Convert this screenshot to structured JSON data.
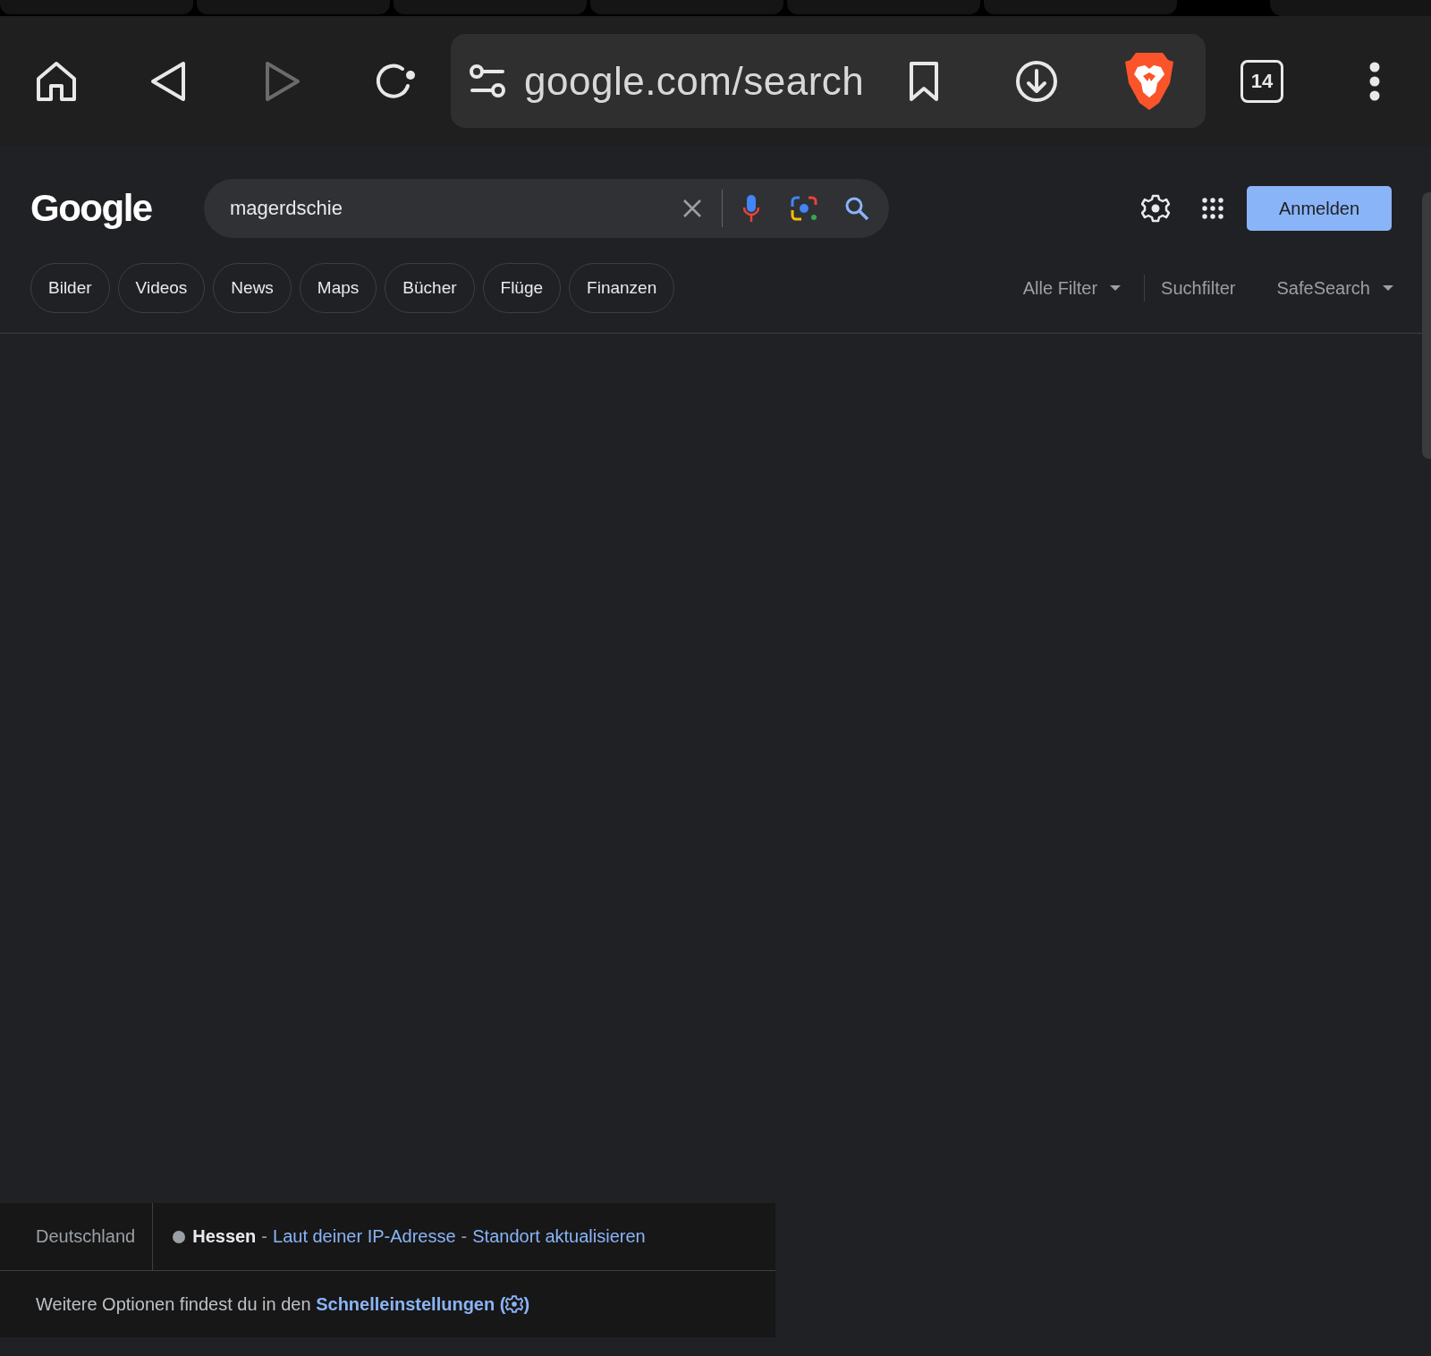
{
  "browser": {
    "nav": [
      {
        "kind": "home",
        "disabled": false
      },
      {
        "kind": "back",
        "disabled": false
      },
      {
        "kind": "forward",
        "disabled": true
      },
      {
        "kind": "reload",
        "disabled": false
      }
    ],
    "url": "google.com/search",
    "tab_count": "14"
  },
  "header": {
    "logo": "Google",
    "query": "magerdschie",
    "sign_in": "Anmelden"
  },
  "chips": [
    "Bilder",
    "Videos",
    "News",
    "Maps",
    "Bücher",
    "Flüge",
    "Finanzen"
  ],
  "filters": [
    {
      "label": "Alle Filter",
      "dropdown": true
    },
    {
      "label": "Suchfilter",
      "dropdown": false
    },
    {
      "label": "SafeSearch",
      "dropdown": true
    }
  ],
  "footer": {
    "country": "Deutschland",
    "region": "Hessen",
    "parts": [
      {
        "kind": "separator",
        "text": "-"
      },
      {
        "kind": "link",
        "text": "Laut deiner IP-Adresse"
      },
      {
        "kind": "separator",
        "text": "-"
      },
      {
        "kind": "link",
        "text": "Standort aktualisieren"
      }
    ],
    "hint": "Weitere Optionen findest du in den",
    "link_text": "Schnelleinstellungen",
    "link_open": "(",
    "link_close": ")"
  }
}
